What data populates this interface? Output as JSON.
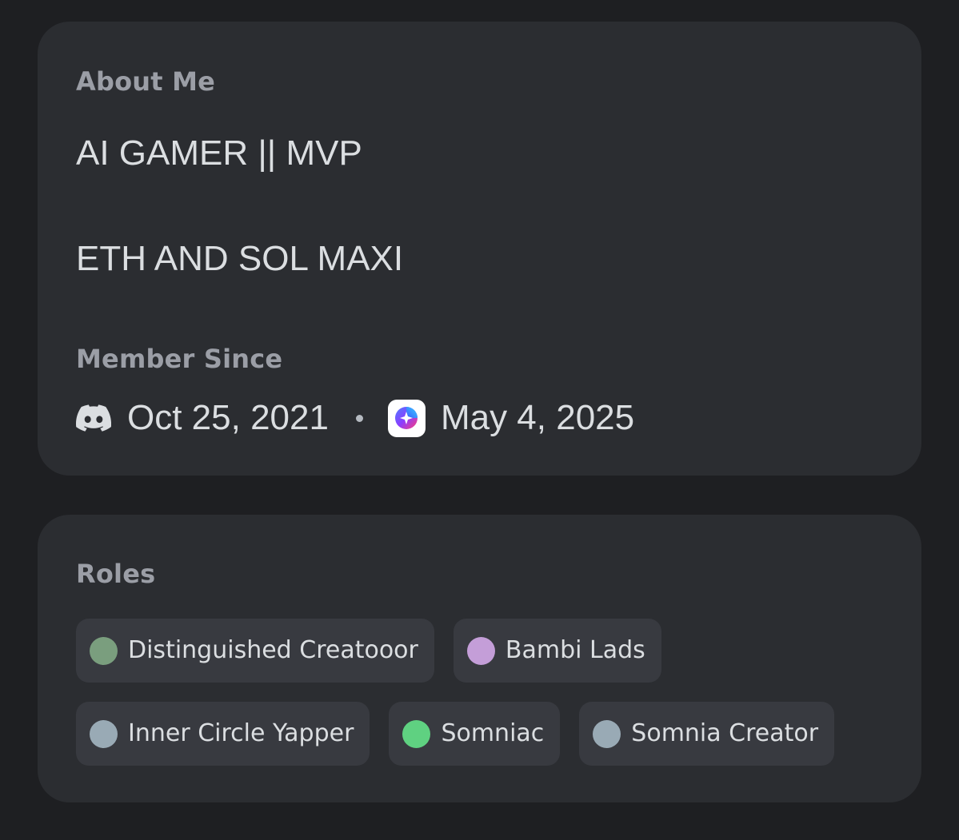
{
  "about": {
    "heading": "About Me",
    "bio_lines": [
      "AI GAMER || MVP",
      "ETH AND SOL MAXI"
    ]
  },
  "member_since": {
    "heading": "Member Since",
    "discord_date": "Oct 25, 2021",
    "server_date": "May 4, 2025",
    "discord_icon": "discord-icon",
    "server_icon": "server-icon"
  },
  "roles": {
    "heading": "Roles",
    "items": [
      {
        "name": "Distinguished Creatooor",
        "color": "#7a9e7e"
      },
      {
        "name": "Bambi Lads",
        "color": "#c49ed8"
      },
      {
        "name": "Inner Circle Yapper",
        "color": "#99aab5"
      },
      {
        "name": "Somniac",
        "color": "#5fd181"
      },
      {
        "name": "Somnia Creator",
        "color": "#99aab5"
      }
    ]
  }
}
